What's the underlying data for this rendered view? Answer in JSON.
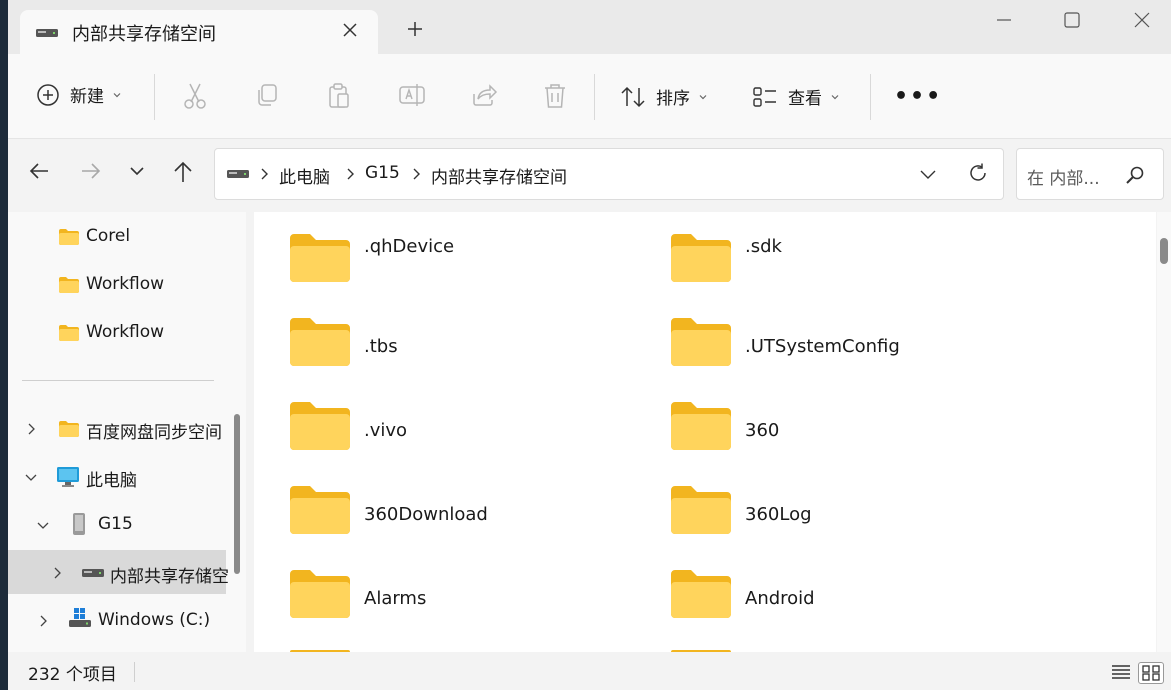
{
  "tab": {
    "title": "内部共享存储空间"
  },
  "toolbar": {
    "new_label": "新建",
    "sort_label": "排序",
    "view_label": "查看",
    "more_label": "•••"
  },
  "address": {
    "crumbs": [
      "此电脑",
      "G15",
      "内部共享存储空间"
    ]
  },
  "search": {
    "placeholder": "在 内部..."
  },
  "nav": {
    "items": [
      {
        "label": "Corel"
      },
      {
        "label": "Workflow"
      },
      {
        "label": "Workflow"
      },
      {
        "label": "百度网盘同步空间"
      },
      {
        "label": "此电脑"
      },
      {
        "label": "G15"
      },
      {
        "label": "内部共享存储空"
      },
      {
        "label": "Windows (C:)"
      }
    ]
  },
  "files": [
    {
      "name": ".qhDevice"
    },
    {
      "name": ".sdk"
    },
    {
      "name": ".tbs"
    },
    {
      "name": ".UTSystemConfig"
    },
    {
      "name": ".vivo"
    },
    {
      "name": "360"
    },
    {
      "name": "360Download"
    },
    {
      "name": "360Log"
    },
    {
      "name": "Alarms"
    },
    {
      "name": "Android"
    }
  ],
  "status": {
    "count": "232 个项目"
  },
  "colors": {
    "folder_back": "#f2b51f",
    "folder_front": "#ffd45c",
    "selection": "#d9d9d9",
    "monitor": "#1f9bd8"
  }
}
